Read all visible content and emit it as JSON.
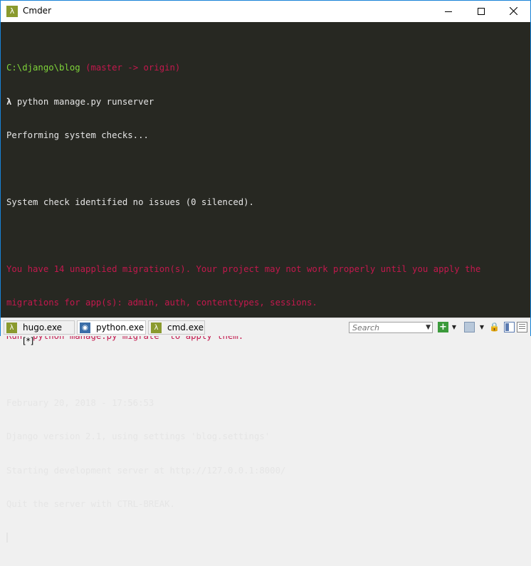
{
  "window": {
    "title": "Cmder"
  },
  "terminal": {
    "prompt_path": "C:\\django\\blog",
    "prompt_branch": "(master -> origin)",
    "lambda": "λ",
    "command": "python manage.py runserver",
    "line_checks": "Performing system checks...",
    "line_empty1": "",
    "line_no_issues": "System check identified no issues (0 silenced).",
    "line_empty2": "",
    "warn1": "You have 14 unapplied migration(s). Your project may not work properly until you apply the",
    "warn2": "migrations for app(s): admin, auth, contenttypes, sessions.",
    "warn3": "Run 'python manage.py migrate' to apply them.",
    "line_empty3": "",
    "line_date": "February 20, 2018 - 17:56:53",
    "line_version": "Django version 2.1, using settings 'blog.settings'",
    "line_server": "Starting development server at http://127.0.0.1:8000/",
    "line_quit": "Quit the server with CTRL-BREAK."
  },
  "tabs": [
    {
      "label": "hugo.exe [*]",
      "icon": "lambda-icon"
    },
    {
      "label": "python.exe",
      "icon": "python-icon"
    },
    {
      "label": "cmd.exe",
      "icon": "lambda-icon"
    }
  ],
  "search": {
    "placeholder": "Search"
  },
  "colors": {
    "terminal_bg": "#272822",
    "prompt_green": "#7fd43a",
    "warning_red": "#c3184d",
    "text": "#e5e5e5"
  }
}
